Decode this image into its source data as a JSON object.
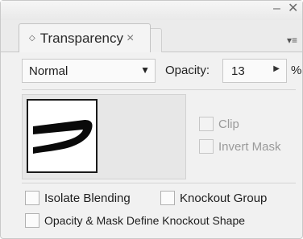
{
  "panel": {
    "minimize_glyph": "–",
    "close_glyph": "✕",
    "menu_glyph": "▾≡"
  },
  "tab": {
    "label": "Transparency",
    "drag_glyph": "◇",
    "close_glyph": "×"
  },
  "blend": {
    "selected": "Normal",
    "arrow_glyph": "▼"
  },
  "opacity": {
    "label": "Opacity:",
    "value": "13",
    "stepper_glyph": "▶",
    "unit": "%"
  },
  "mask_options": {
    "clip": "Clip",
    "invert_mask": "Invert Mask"
  },
  "options": {
    "isolate_blending": "Isolate Blending",
    "knockout_group": "Knockout Group",
    "opacity_mask_knockout": "Opacity & Mask Define Knockout Shape"
  }
}
